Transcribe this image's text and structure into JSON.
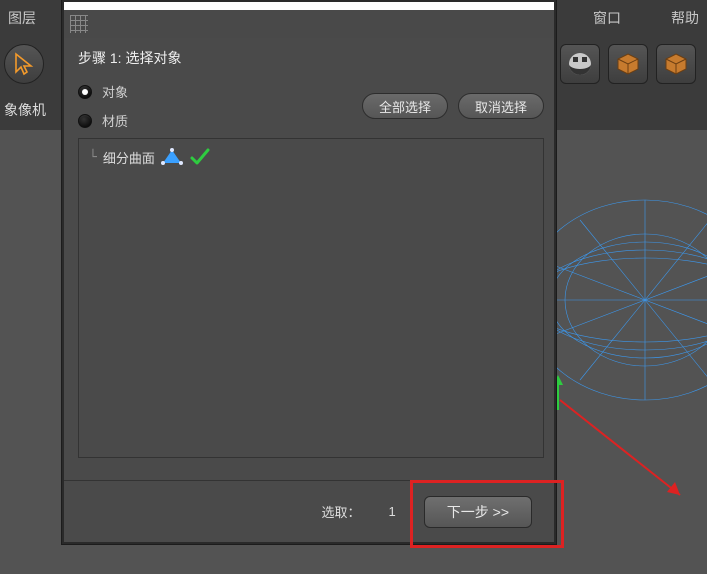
{
  "menu": {
    "layers": "图层",
    "window": "窗口",
    "help": "帮助"
  },
  "secondbar": {
    "camera": "象像机"
  },
  "dialog": {
    "step_title": "步骤 1: 选择对象",
    "radio": {
      "object": "对象",
      "material": "材质"
    },
    "buttons": {
      "select_all": "全部选择",
      "deselect": "取消选择"
    },
    "tree": {
      "item0": "细分曲面"
    },
    "footer": {
      "selected_label": "选取：",
      "selected_count": "1",
      "next": "下一步 >>"
    }
  },
  "icons": {
    "grid": "grid-icon",
    "arrow_tool": "arrow-tool",
    "cube": "cube-icon",
    "checker": "checker-icon"
  }
}
